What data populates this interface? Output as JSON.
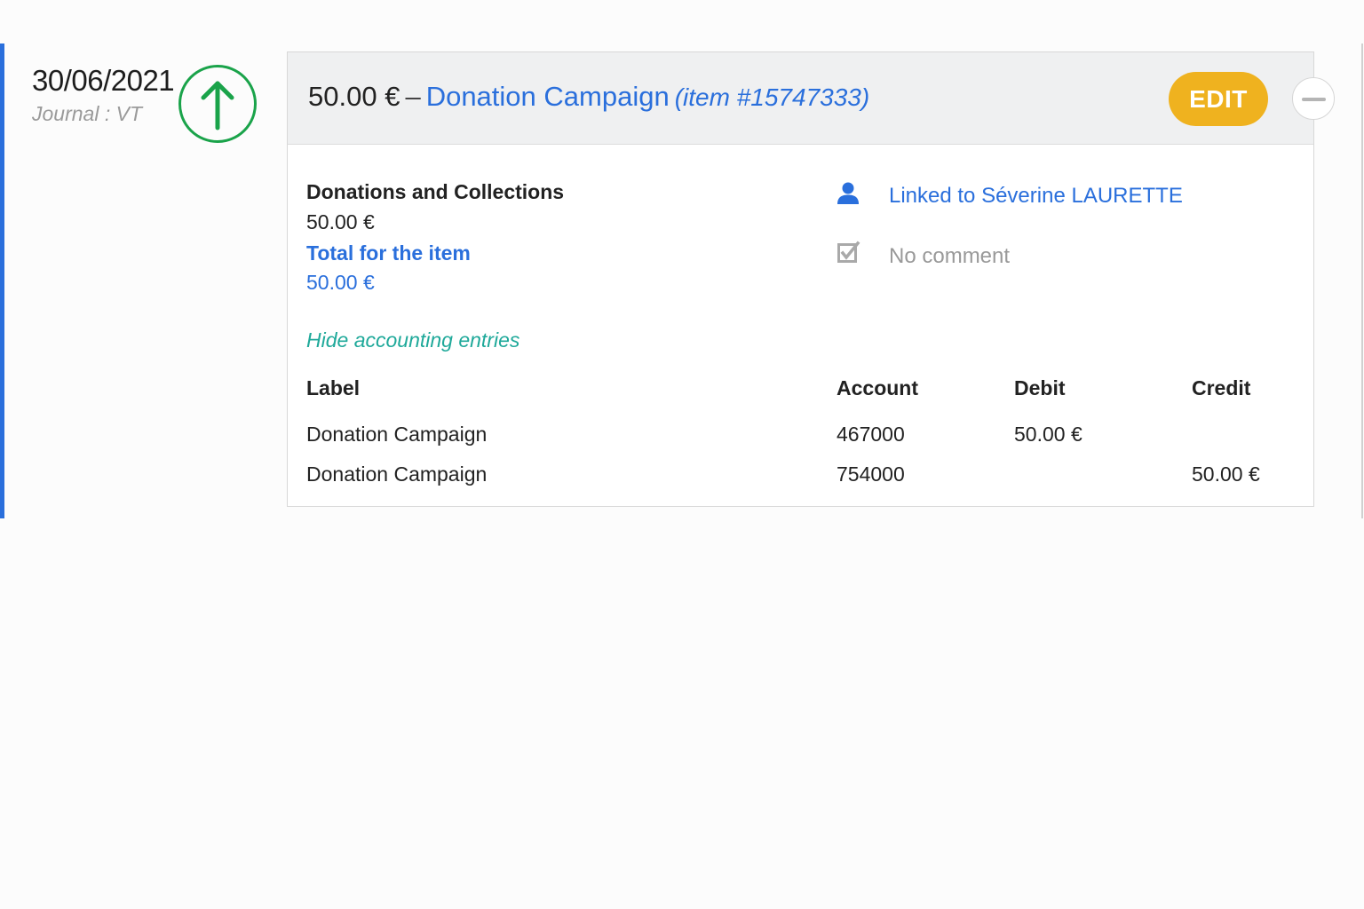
{
  "entry": {
    "date": "30/06/2021",
    "journal": "Journal : VT",
    "direction_icon": "arrow-up-icon",
    "direction_color": "#1aa34a"
  },
  "header": {
    "amount": "50.00 €",
    "separator": "–",
    "campaign_name": "Donation Campaign",
    "item_ref": "(item #15747333)",
    "edit_label": "EDIT",
    "collapse_icon": "minus-icon"
  },
  "details": {
    "category_title": "Donations and Collections",
    "category_value": "50.00 €",
    "total_label": "Total for the item",
    "total_value": "50.00 €",
    "linked_icon": "person-icon",
    "linked_text": "Linked to Séverine LAURETTE",
    "comment_icon": "edit-note-icon",
    "comment_text": "No comment",
    "toggle_entries": "Hide accounting entries"
  },
  "entries_table": {
    "headers": {
      "label": "Label",
      "account": "Account",
      "debit": "Debit",
      "credit": "Credit"
    },
    "rows": [
      {
        "label": "Donation Campaign",
        "account": "467000",
        "debit": "50.00 €",
        "credit": ""
      },
      {
        "label": "Donation Campaign",
        "account": "754000",
        "debit": "",
        "credit": "50.00 €"
      }
    ]
  },
  "colors": {
    "accent_blue": "#2a6fdc",
    "edit_yellow": "#efb21f",
    "teal_link": "#1fa99a",
    "header_bg": "#eff0f1"
  }
}
